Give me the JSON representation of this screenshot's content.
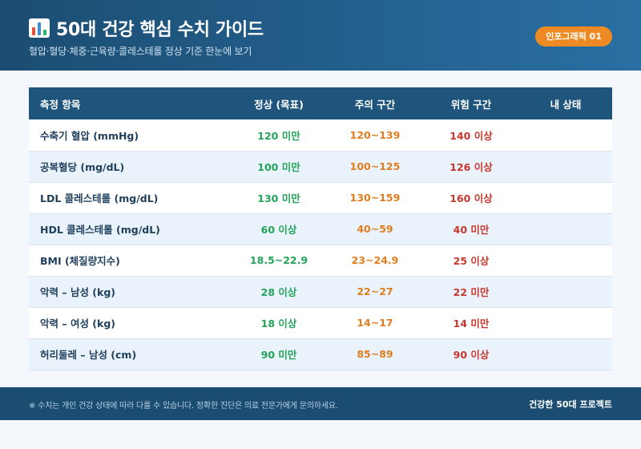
{
  "header": {
    "title_icon": "bar-chart-icon",
    "title": "50대 건강 핵심 수치 가이드",
    "subtitle": "혈압·혈당·체중·근육량·콜레스테롤 정상 기준 한눈에 보기",
    "badge": "인포그래픽 01"
  },
  "table": {
    "columns": [
      "측정 항목",
      "정상 (목표)",
      "주의 구간",
      "위험 구간",
      "내 상태"
    ],
    "rows": [
      {
        "item": "수축기 혈압 (mmHg)",
        "normal": "120 미만",
        "caution": "120~139",
        "danger": "140 이상",
        "mine": ""
      },
      {
        "item": "공복혈당 (mg/dL)",
        "normal": "100 미만",
        "caution": "100~125",
        "danger": "126 이상",
        "mine": ""
      },
      {
        "item": "LDL 콜레스테롤 (mg/dL)",
        "normal": "130 미만",
        "caution": "130~159",
        "danger": "160 이상",
        "mine": ""
      },
      {
        "item": "HDL 콜레스테롤 (mg/dL)",
        "normal": "60 이상",
        "caution": "40~59",
        "danger": "40 미만",
        "mine": ""
      },
      {
        "item": "BMI (체질량지수)",
        "normal": "18.5~22.9",
        "caution": "23~24.9",
        "danger": "25 이상",
        "mine": ""
      },
      {
        "item": "악력 – 남성 (kg)",
        "normal": "28 이상",
        "caution": "22~27",
        "danger": "22 미만",
        "mine": ""
      },
      {
        "item": "악력 – 여성 (kg)",
        "normal": "18 이상",
        "caution": "14~17",
        "danger": "14 미만",
        "mine": ""
      },
      {
        "item": "허리둘레 – 남성 (cm)",
        "normal": "90 미만",
        "caution": "85~89",
        "danger": "90 이상",
        "mine": ""
      }
    ]
  },
  "footer": {
    "note": "※ 수치는 개인 건강 상태에 따라 다를 수 있습니다. 정확한 진단은 의료 전문가에게 문의하세요.",
    "brand": "건강한 50대 프로젝트"
  },
  "colors": {
    "header_bg": "#1b4d72",
    "table_header_bg": "#1f547c",
    "normal": "#24a35a",
    "caution": "#e07d1f",
    "danger": "#c8372d",
    "badge": "#ee8a23"
  }
}
